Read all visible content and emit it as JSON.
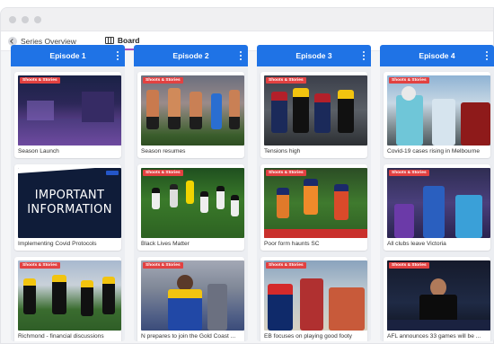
{
  "window": {
    "buttons": [
      "close",
      "minimize",
      "maximize"
    ]
  },
  "tabs": {
    "back_label": "Series Overview",
    "board_label": "Board",
    "accent": "#a64ec4"
  },
  "header_color": "#1f73e6",
  "tag_color": "#e24141",
  "columns": [
    {
      "title": "Episode 1",
      "cards": [
        {
          "tag": "Shoots & Stories",
          "caption": "Season Launch"
        },
        {
          "tag": "",
          "caption": "Implementing Covid Protocols",
          "image_text": [
            "IMPORTANT",
            "INFORMATION"
          ]
        },
        {
          "tag": "Shoots & Stories",
          "caption": "Richmond - financial discussions"
        }
      ]
    },
    {
      "title": "Episode 2",
      "cards": [
        {
          "tag": "Shoots & Stories",
          "caption": "Season resumes"
        },
        {
          "tag": "Shoots & Stories",
          "caption": "Black Lives Matter"
        },
        {
          "tag": "Shoots & Stories",
          "caption": "N prepares to join the Gold Coast ..."
        }
      ]
    },
    {
      "title": "Episode 3",
      "cards": [
        {
          "tag": "Shoots & Stories",
          "caption": "Tensions high"
        },
        {
          "tag": "Shoots & Stories",
          "caption": "Poor form haunts SC"
        },
        {
          "tag": "Shoots & Stories",
          "caption": "EB focuses on playing good footy"
        }
      ]
    },
    {
      "title": "Episode 4",
      "cards": [
        {
          "tag": "Shoots & Stories",
          "caption": "Covid-19 cases rising in Melbourne"
        },
        {
          "tag": "Shoots & Stories",
          "caption": "All clubs leave Victoria"
        },
        {
          "tag": "Shoots & Stories",
          "caption": "AFL announces 33 games will be ..."
        }
      ]
    }
  ]
}
